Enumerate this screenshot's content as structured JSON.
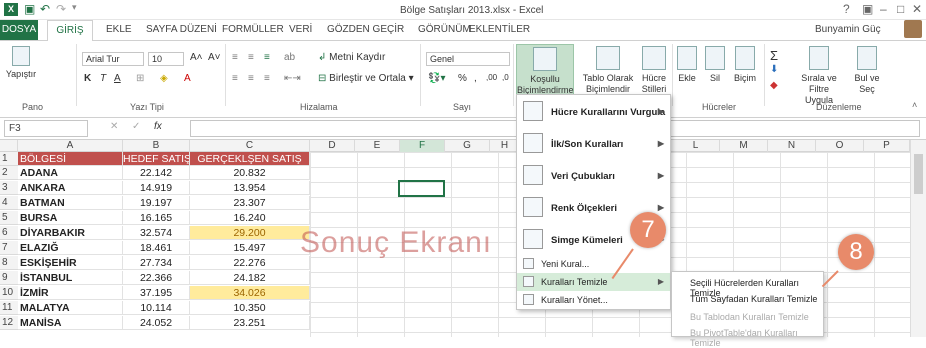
{
  "window": {
    "title": "Bölge Satışları 2013.xlsx - Excel",
    "help": "?",
    "user": "Bunyamin Güç"
  },
  "tabs": [
    "DOSYA",
    "GİRİŞ",
    "EKLE",
    "SAYFA DÜZENİ",
    "FORMÜLLER",
    "VERİ",
    "GÖZDEN GEÇİR",
    "GÖRÜNÜM",
    "EKLENTİLER"
  ],
  "ribbon": {
    "paste": "Yapıştır",
    "font_name": "Arial Tur",
    "font_size": "10",
    "wrap_text": "Metni Kaydır",
    "merge_center": "Birleştir ve Ortala",
    "number_format": "Genel",
    "cond_format_1": "Koşullu",
    "cond_format_2": "Biçimlendirme",
    "format_table_1": "Tablo Olarak",
    "format_table_2": "Biçimlendir",
    "cell_styles_1": "Hücre",
    "cell_styles_2": "Stilleri",
    "insert": "Ekle",
    "delete": "Sil",
    "format": "Biçim",
    "sort_filter_1": "Sırala ve Filtre",
    "sort_filter_2": "Uygula",
    "find_1": "Bul ve",
    "find_2": "Seç",
    "groups": [
      "Pano",
      "Yazı Tipi",
      "Hizalama",
      "Sayı",
      "Hücreler",
      "Düzenleme"
    ]
  },
  "name_box": "F3",
  "fx": "fx",
  "columns": [
    "A",
    "B",
    "C",
    "D",
    "E",
    "F",
    "G",
    "H",
    "L",
    "M",
    "N",
    "O",
    "P"
  ],
  "headers": {
    "a": "BÖLGESİ",
    "b": "HEDEF SATIŞ",
    "c": "GERÇEKLŞEN SATIŞ"
  },
  "rows": [
    {
      "n": "2",
      "a": "ADANA",
      "b": "22.142",
      "c": "20.832",
      "hl": false
    },
    {
      "n": "3",
      "a": "ANKARA",
      "b": "14.919",
      "c": "13.954",
      "hl": false
    },
    {
      "n": "4",
      "a": "BATMAN",
      "b": "19.197",
      "c": "23.307",
      "hl": false
    },
    {
      "n": "5",
      "a": "BURSA",
      "b": "16.165",
      "c": "16.240",
      "hl": false
    },
    {
      "n": "6",
      "a": "DİYARBAKIR",
      "b": "32.574",
      "c": "29.200",
      "hl": true
    },
    {
      "n": "7",
      "a": "ELAZIĞ",
      "b": "18.461",
      "c": "15.497",
      "hl": false
    },
    {
      "n": "8",
      "a": "ESKİŞEHİR",
      "b": "27.734",
      "c": "22.276",
      "hl": false
    },
    {
      "n": "9",
      "a": "İSTANBUL",
      "b": "22.366",
      "c": "24.182",
      "hl": false
    },
    {
      "n": "10",
      "a": "İZMİR",
      "b": "37.195",
      "c": "34.026",
      "hl": true
    },
    {
      "n": "11",
      "a": "MALATYA",
      "b": "10.114",
      "c": "10.350",
      "hl": false
    },
    {
      "n": "12",
      "a": "MANİSA",
      "b": "24.052",
      "c": "23.251",
      "hl": false
    }
  ],
  "menu": {
    "highlight_rules": "Hücre Kurallarını Vurgula",
    "top_bottom": "İlk/Son Kuralları",
    "data_bars": "Veri Çubukları",
    "color_scales": "Renk Ölçekleri",
    "icon_sets": "Simge Kümeleri",
    "new_rule": "Yeni Kural...",
    "clear_rules": "Kuralları Temizle",
    "manage_rules": "Kuralları Yönet..."
  },
  "submenu": {
    "selected_cells": "Seçili Hücrelerden Kuralları Temizle",
    "entire_sheet": "Tüm Sayfadan Kuralları Temizle",
    "this_table": "Bu Tablodan Kuralları Temizle",
    "pivot_table": "Bu PivotTable'dan Kuralları Temizle"
  },
  "overlay": {
    "caption": "Sonuç Ekranı",
    "step7": "7",
    "step8": "8"
  },
  "colors": {
    "accent": "#217346",
    "header_fill": "#c0504d",
    "highlight_fill": "#ffeb9c",
    "badge": "#e88a6a"
  }
}
